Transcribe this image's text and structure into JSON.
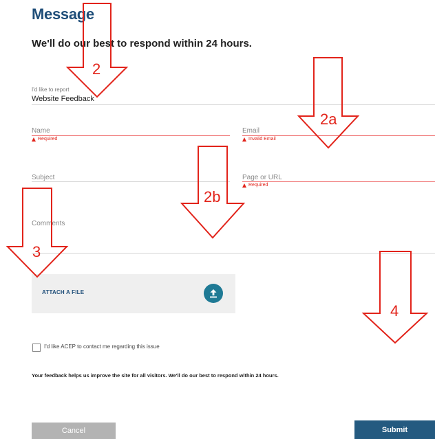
{
  "page": {
    "title": "Message",
    "subtitle": "We'll do our best to respond within 24 hours."
  },
  "form": {
    "report": {
      "label": "I'd like to report",
      "value": "Website Feedback"
    },
    "name": {
      "placeholder": "Name",
      "error": "Required"
    },
    "email": {
      "placeholder": "Email",
      "error": "Invalid Email"
    },
    "subject": {
      "placeholder": "Subject"
    },
    "page_url": {
      "placeholder": "Page or URL",
      "error": "Required"
    },
    "comments": {
      "placeholder": "Comments"
    },
    "attach": {
      "label": "ATTACH A FILE",
      "icon": "upload-icon"
    },
    "contact_checkbox": {
      "label": "I'd like ACEP to contact me regarding this issue",
      "checked": false
    },
    "footer_note": "Your feedback helps us improve the site for all visitors. We'll do our best to respond within 24 hours."
  },
  "buttons": {
    "cancel": "Cancel",
    "submit": "Submit"
  },
  "annotations": {
    "arrow_color": "#e2231a",
    "labels": [
      "2",
      "2a",
      "2b",
      "3",
      "4"
    ]
  },
  "colors": {
    "brand": "#1f4e79",
    "error": "#e2231a",
    "submit_bg": "#245a80",
    "cancel_bg": "#b3b3b3"
  }
}
